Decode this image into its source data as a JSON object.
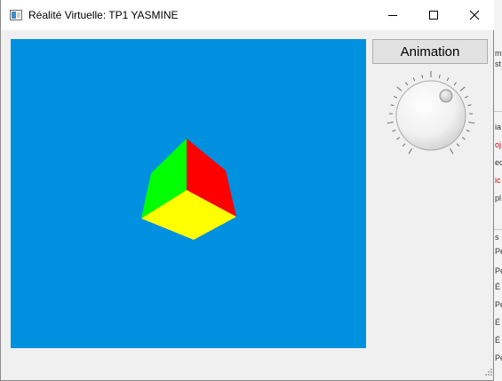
{
  "window": {
    "title": "Réalité Virtuelle: TP1 YASMINE",
    "controls": {
      "minimize": "minimize-icon",
      "maximize": "maximize-icon",
      "close": "close-icon"
    }
  },
  "viewport": {
    "background_color": "#0090e0",
    "cube_face_colors": {
      "left": "#00ff00",
      "right": "#ff0000",
      "bottom": "#ffff00"
    }
  },
  "side_panel": {
    "animation_button_label": "Animation",
    "dial_icon": "rotation-dial"
  },
  "background_app_fragments": [
    "m",
    "st",
    "ia",
    "oj",
    "ec",
    "ic",
    "pl",
    "s",
    "Pe",
    "Pe",
    "É",
    "Pe",
    "É",
    "É",
    "Pe"
  ]
}
